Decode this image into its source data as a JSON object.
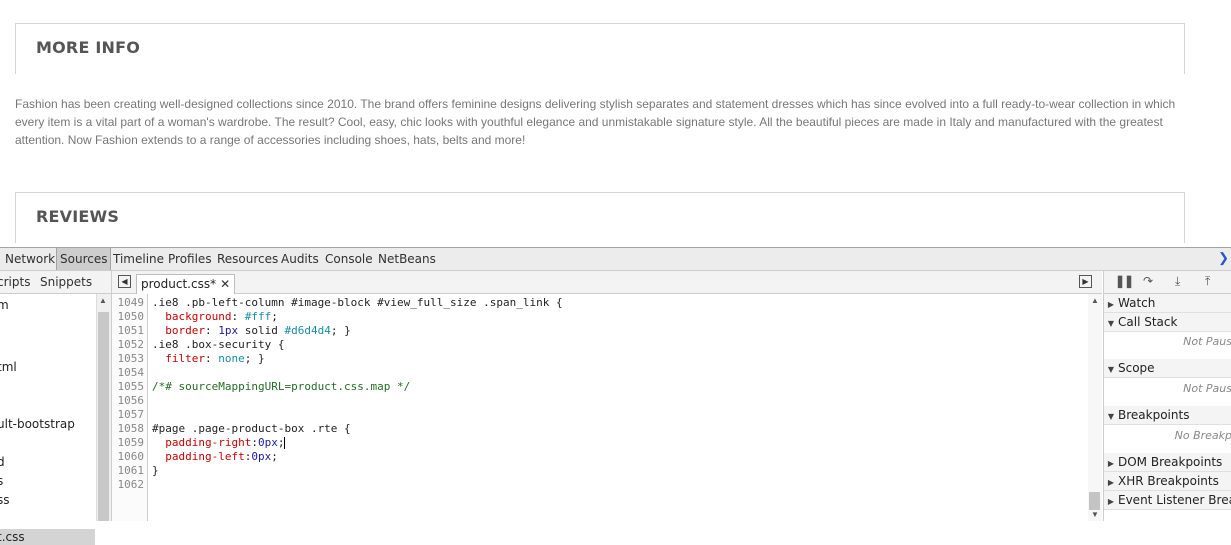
{
  "page": {
    "more_info_title": "MORE INFO",
    "description": "Fashion has been creating well-designed collections since 2010. The brand offers feminine designs delivering stylish separates and statement dresses which has since evolved into a full ready-to-wear collection in which every item is a vital part of a woman's wardrobe. The result? Cool, easy, chic looks with youthful elegance and unmistakable signature style. All the beautiful pieces are made in Italy and manufactured with the greatest attention. Now Fashion extends to a range of accessories including shoes, hats, belts and more!",
    "reviews_title": "REVIEWS"
  },
  "devtools": {
    "tabs": [
      "Network",
      "Sources",
      "Timeline",
      "Profiles",
      "Resources",
      "Audits",
      "Console",
      "NetBeans"
    ],
    "selected_tab": "Sources",
    "navigator": {
      "tabs": [
        "cripts",
        "Snippets"
      ],
      "items": [
        "m",
        "tml",
        "ult-bootstrap",
        "d",
        "s",
        "ss",
        "t.css"
      ],
      "selected_item": "t.css"
    },
    "editor": {
      "file_tab": "product.css*",
      "close_glyph": "✕",
      "line_numbers": [
        "1049",
        "1050",
        "1051",
        "1052",
        "1053",
        "1054",
        "1055",
        "1056",
        "1057",
        "1058",
        "1059",
        "1060",
        "1061",
        "1062"
      ],
      "lines": [
        ".ie8 .pb-left-column #image-block #view_full_size .span_link {",
        "  background: #fff;",
        "  border: 1px solid #d6d4d4; }",
        ".ie8 .box-security {",
        "  filter: none; }",
        "",
        "/*# sourceMappingURL=product.css.map */",
        "",
        "",
        "#page .page-product-box .rte {",
        "  padding-right:0px;",
        "  padding-left:0px;",
        "}",
        ""
      ]
    },
    "sidebar": {
      "panes": [
        {
          "label": "Watch",
          "expanded": false
        },
        {
          "label": "Call Stack",
          "expanded": true,
          "body": "Not Paus"
        },
        {
          "label": "Scope",
          "expanded": true,
          "body": "Not Paus"
        },
        {
          "label": "Breakpoints",
          "expanded": true,
          "body": "No Breakp"
        },
        {
          "label": "DOM Breakpoints",
          "expanded": false
        },
        {
          "label": "XHR Breakpoints",
          "expanded": false
        },
        {
          "label": "Event Listener Breakp",
          "expanded": false
        }
      ]
    }
  }
}
